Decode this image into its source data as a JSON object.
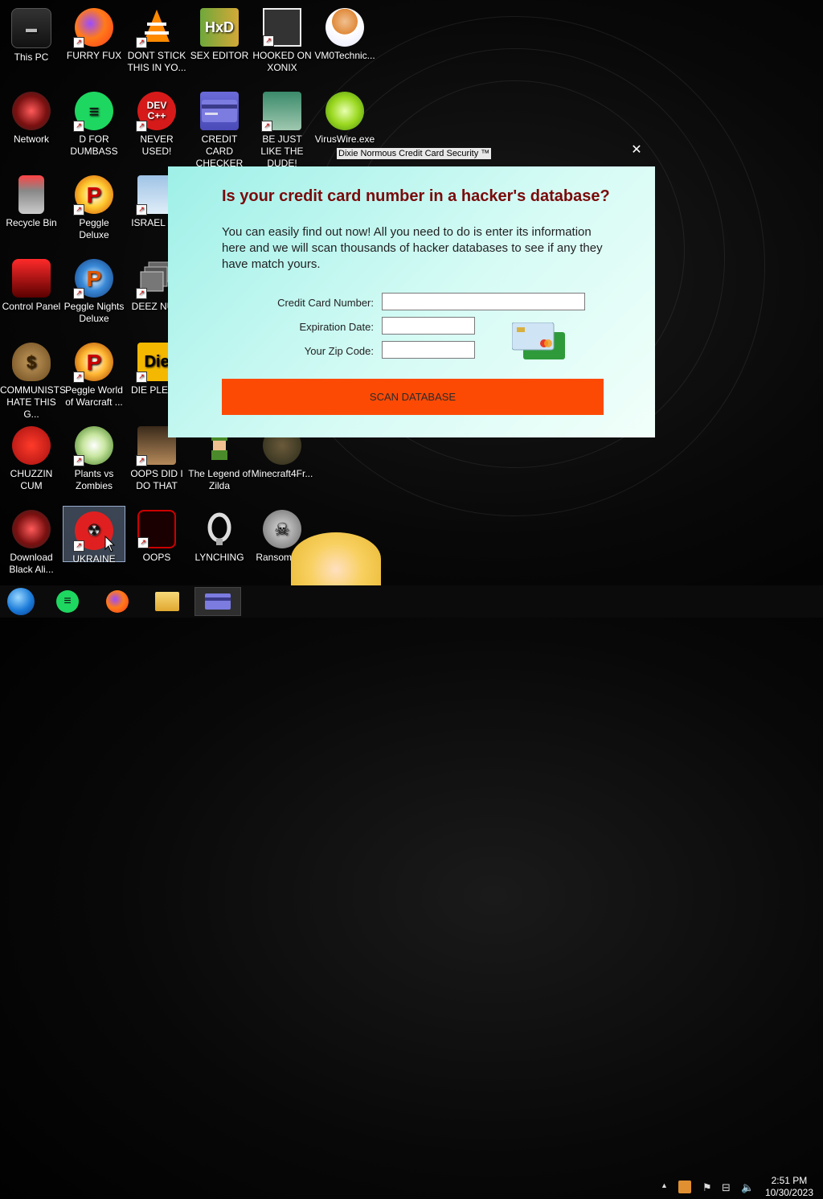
{
  "desktop": {
    "icons": [
      {
        "label": "This PC"
      },
      {
        "label": "FURRY FUX"
      },
      {
        "label": "DONT STICK THIS IN YO..."
      },
      {
        "label": "SEX EDITOR"
      },
      {
        "label": "HOOKED ON XONIX"
      },
      {
        "label": "VM0Technic..."
      },
      {
        "label": "Network"
      },
      {
        "label": "D FOR DUMBASS"
      },
      {
        "label": "NEVER USED!"
      },
      {
        "label": "CREDIT CARD CHECKER"
      },
      {
        "label": "BE JUST LIKE THE DUDE!"
      },
      {
        "label": "VirusWire.exe"
      },
      {
        "label": "Recycle Bin"
      },
      {
        "label": "Peggle Deluxe"
      },
      {
        "label": "ISRAEL S..."
      },
      {
        "label": "Control Panel"
      },
      {
        "label": "Peggle Nights Deluxe"
      },
      {
        "label": "DEEZ NU..."
      },
      {
        "label": "COMMUNISTS HATE THIS G..."
      },
      {
        "label": "Peggle World of Warcraft ..."
      },
      {
        "label": "DIE PLEA..."
      },
      {
        "label": "CHUZZIN CUM"
      },
      {
        "label": "Plants vs Zombies"
      },
      {
        "label": "OOPS DID I DO THAT"
      },
      {
        "label": "The Legend of Zilda"
      },
      {
        "label": "Minecraft4Fr..."
      },
      {
        "label": "Download Black Ali..."
      },
      {
        "label": "UKRAINE"
      },
      {
        "label": "OOPS"
      },
      {
        "label": "LYNCHING"
      },
      {
        "label": "RansomW..."
      }
    ],
    "dev_icon_text": "DEV C++",
    "die_icon_text": "Die"
  },
  "app": {
    "window_title": "Dixie Normous Credit Card Security ™",
    "close_label": "✕",
    "heading": "Is your credit card number in a hacker's database?",
    "intro": "You can easily find out now! All you need to do is enter its information here and we will scan thousands of hacker databases to see if any they have match yours.",
    "fields": {
      "card_number_label": "Credit Card Number:",
      "card_number_value": "",
      "expiration_label": "Expiration Date:",
      "expiration_value": "",
      "zip_label": "Your Zip Code:",
      "zip_value": ""
    },
    "scan_button": "SCAN DATABASE",
    "colors": {
      "heading": "#7a0a0a",
      "button": "#fc4a05",
      "panel_start": "#9ef0e8",
      "panel_end": "#f2fffa"
    }
  },
  "taskbar": {
    "items": [
      {
        "icon": "start-orb-icon"
      },
      {
        "icon": "notes-app-icon"
      },
      {
        "icon": "firefox-icon"
      },
      {
        "icon": "file-explorer-icon"
      },
      {
        "icon": "credit-card-app-icon",
        "active": true
      }
    ],
    "tray": {
      "chevron": "▲",
      "icons": [
        "app-tray-icon",
        "flag-icon",
        "network-icon",
        "volume-icon"
      ]
    },
    "clock": {
      "time": "2:51 PM",
      "date": "10/30/2023"
    }
  }
}
